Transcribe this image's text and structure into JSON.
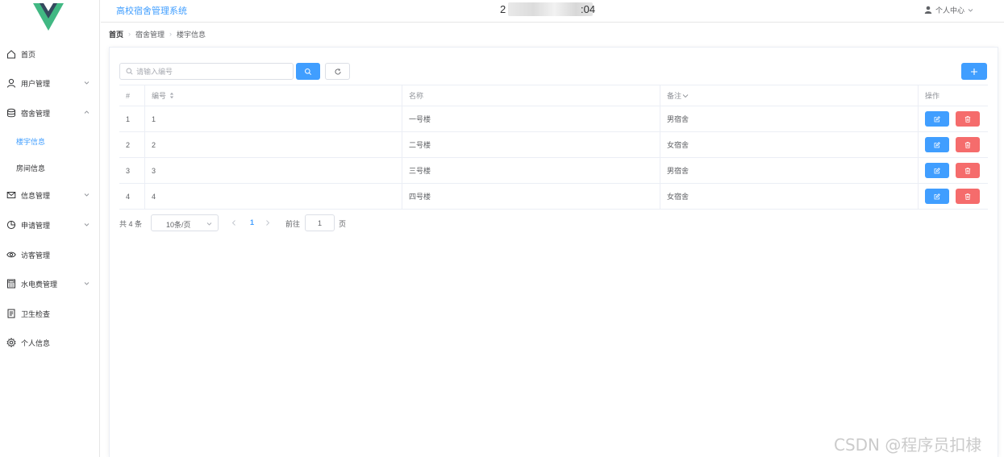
{
  "app": {
    "title": "高校宿舍管理系统",
    "clock": {
      "prefix": "2",
      "suffix": ":04"
    },
    "user_menu_label": "个人中心"
  },
  "sidebar": {
    "items": [
      {
        "label": "首页",
        "icon": "home-icon"
      },
      {
        "label": "用户管理",
        "icon": "user-icon",
        "expandable": true
      },
      {
        "label": "宿舍管理",
        "icon": "database-icon",
        "expandable": true,
        "expanded": true
      },
      {
        "label": "信息管理",
        "icon": "mail-icon",
        "expandable": true
      },
      {
        "label": "申请管理",
        "icon": "pie-chart-icon",
        "expandable": true
      },
      {
        "label": "访客管理",
        "icon": "eye-icon"
      },
      {
        "label": "水电费管理",
        "icon": "calculator-icon",
        "expandable": true
      },
      {
        "label": "卫生检查",
        "icon": "document-icon"
      },
      {
        "label": "个人信息",
        "icon": "gear-icon"
      }
    ],
    "submenu": [
      {
        "label": "楼宇信息",
        "active": true
      },
      {
        "label": "房间信息",
        "active": false
      }
    ]
  },
  "breadcrumb": [
    "首页",
    "宿舍管理",
    "楼宇信息"
  ],
  "toolbar": {
    "search_placeholder": "请输入编号",
    "search_value": ""
  },
  "table": {
    "headers": [
      "#",
      "编号",
      "名称",
      "备注",
      "操作"
    ],
    "rows": [
      {
        "index": "1",
        "code": "1",
        "name": "一号楼",
        "note": "男宿舍"
      },
      {
        "index": "2",
        "code": "2",
        "name": "二号楼",
        "note": "女宿舍"
      },
      {
        "index": "3",
        "code": "3",
        "name": "三号楼",
        "note": "男宿舍"
      },
      {
        "index": "4",
        "code": "4",
        "name": "四号楼",
        "note": "女宿舍"
      }
    ]
  },
  "pagination": {
    "total": "共 4 条",
    "page_size": "10条/页",
    "current_page": "1",
    "goto_label": "前往",
    "goto_value": "1",
    "page_suffix": "页"
  },
  "watermark": "CSDN @程序员扣棣",
  "colors": {
    "primary": "#409eff",
    "danger": "#f56c6c",
    "logo_green": "#41b883",
    "logo_dark": "#34495e"
  }
}
